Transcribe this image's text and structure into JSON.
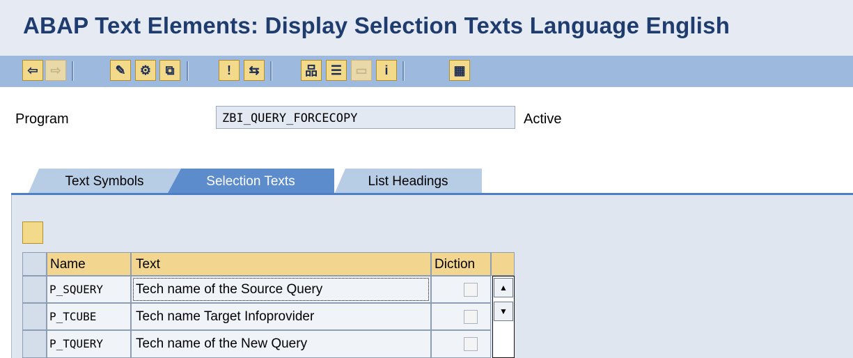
{
  "window": {
    "title": "ABAP Text Elements: Display Selection Texts Language English"
  },
  "toolbar": {
    "buttons": [
      {
        "name": "back-arrow-icon",
        "glyph": "⇦"
      },
      {
        "name": "forward-arrow-icon",
        "glyph": "⇨"
      },
      {
        "name": "display-change-icon",
        "glyph": "✎"
      },
      {
        "name": "active-inactive-icon",
        "glyph": "⚙"
      },
      {
        "name": "other-object-icon",
        "glyph": "⧉"
      },
      {
        "name": "where-used-icon",
        "glyph": "!"
      },
      {
        "name": "navigate-icon",
        "glyph": "⇆"
      },
      {
        "name": "hierarchy-icon",
        "glyph": "品"
      },
      {
        "name": "list-icon",
        "glyph": "☰"
      },
      {
        "name": "detail-icon",
        "glyph": "▭"
      },
      {
        "name": "info-icon",
        "glyph": "i"
      },
      {
        "name": "layout-icon",
        "glyph": "▦"
      }
    ]
  },
  "header": {
    "program_label": "Program",
    "program_value": "ZBI_QUERY_FORCECOPY",
    "status": "Active"
  },
  "tabs": [
    {
      "label": "Text Symbols",
      "active": false
    },
    {
      "label": "Selection Texts",
      "active": true
    },
    {
      "label": "List Headings",
      "active": false
    }
  ],
  "table": {
    "columns": [
      "Name",
      "Text",
      "Diction"
    ],
    "rows": [
      {
        "name": "P_SQUERY",
        "text": "Tech name of the Source Query",
        "diction": false
      },
      {
        "name": "P_TCUBE",
        "text": "Tech name Target Infoprovider",
        "diction": false
      },
      {
        "name": "P_TQUERY",
        "text": "Tech name of the New Query",
        "diction": false
      }
    ]
  },
  "colors": {
    "title": "#1f3c6e",
    "toolbar": "#9db9dd",
    "header_cell": "#f2d58f",
    "active_tab": "#5c8ccc"
  }
}
